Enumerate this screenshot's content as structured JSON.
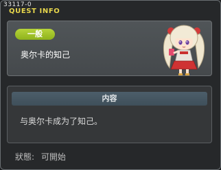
{
  "window": {
    "quest_id": "33117-0",
    "title": "QUEST INFO"
  },
  "quest": {
    "category": "一般",
    "name": "奥尔卡的知己",
    "npc_icon": "npc-orca-portrait"
  },
  "content": {
    "header": "内容",
    "text": "与奥尔卡成为了知己。"
  },
  "status": {
    "label": "狀態:",
    "value": "可開始"
  },
  "colors": {
    "title": "#e7d64c",
    "badge": "#9bbd22",
    "content_header": "#465864"
  }
}
